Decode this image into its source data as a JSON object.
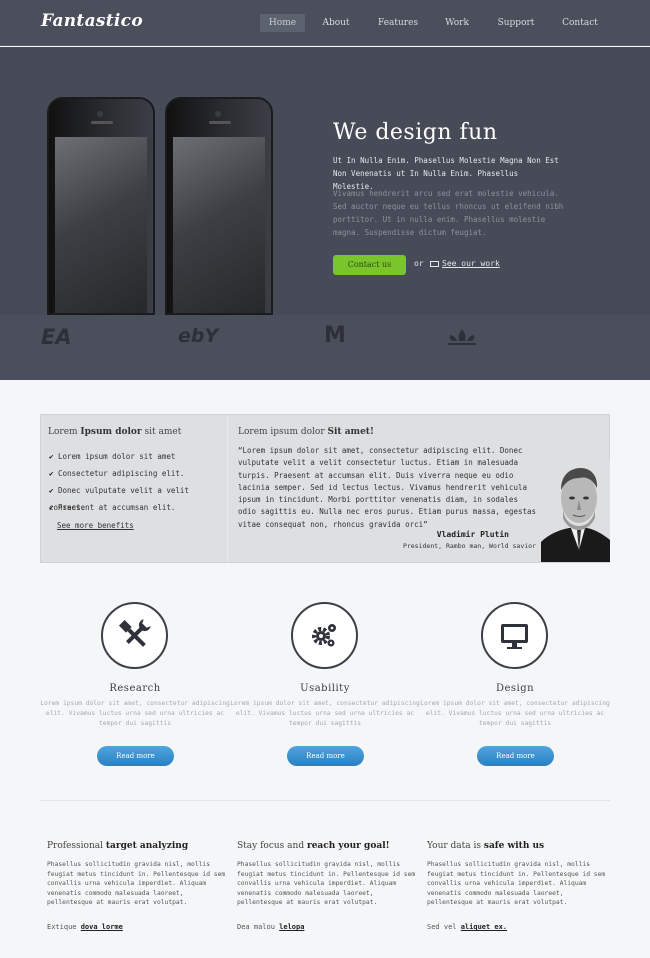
{
  "brand": {
    "logo": "Fantastico"
  },
  "nav": {
    "items": [
      "Home",
      "About",
      "Features",
      "Work",
      "Support",
      "Contact"
    ]
  },
  "hero": {
    "title": "We design fun",
    "subtitle": "Ut In Nulla Enim. Phasellus Molestie Magna Non Est Non Venenatis ut In Nulla Enim. Phasellus Molestie.",
    "text": "Vivamus hendrerit arcu sed erat molestie vehicula. Sed auctor neque eu tellus rhoncus ut eleifend nibh porttitor. Ut in nulla enim. Phasellus molestie magna. Suspendisse dictum feugiat.",
    "contact_label": "Contact us",
    "or_label": "or",
    "see_work_label": "See our work"
  },
  "clients": [
    "EA",
    "ebY",
    "M",
    "adidas"
  ],
  "testimonial": {
    "left_title_pre": "Lorem ",
    "left_title_bold": "Ipsum dolor",
    "left_title_post": " sit amet",
    "bullets": [
      "Lorem ipsum dolor sit amet",
      "Consectetur adipiscing elit.",
      "Donec vulputate velit a velit consect.",
      "Praesent at accumsan elit."
    ],
    "see_more": "See more benefits",
    "right_title_pre": "Lorem ipsum dolor ",
    "right_title_bold": "Sit amet!",
    "quote": "“Lorem ipsum dolor sit amet, consectetur adipiscing elit. Donec vulputate velit a velit consectetur luctus. Etiam in malesuada turpis. Praesent at accumsan elit. Duis viverra neque eu odio lacinia semper. Sed id lectus lectus. Vivamus hendrerit vehicula ipsum in tincidunt. Morbi porttitor venenatis diam, in sodales odio sagittis eu. Nulla nec eros purus. Etiam purus massa, egestas vitae consequat non, rhoncus gravida orci”",
    "name": "Vladimir Plutin",
    "role": "President, Rambo man, World savior"
  },
  "features": [
    {
      "icon": "tools-icon",
      "title": "Research",
      "text": "Lorem ipsum dolor sit amet, consectetur adipiscing elit. Vivamus luctus urna sed urna ultricies ac tempor dui sagittis",
      "button": "Read more"
    },
    {
      "icon": "gears-icon",
      "title": "Usability",
      "text": "Lorem ipsum dolor sit amet, consectetur adipiscing elit. Vivamus luctus urna sed urna ultricies ac tempor dui sagittis",
      "button": "Read more"
    },
    {
      "icon": "monitor-icon",
      "title": "Design",
      "text": "Lorem ipsum dolor sit amet, consectetur adipiscing elit. Vivamus luctus urna sed urna ultricies ac tempor dui sagittis",
      "button": "Read more"
    }
  ],
  "bottom": [
    {
      "title_pre": "Professional ",
      "title_bold": "target analyzing",
      "text": "Phasellus sollicitudin gravida nisl, mollis feugiat metus tincidunt in. Pellentesque id sem convallis urna vehicula imperdiet. Aliquam venenatis commodo malesuada laoreet, pellentesque at mauris erat volutpat.",
      "link_pre": "Extique ",
      "link": "dova lorme"
    },
    {
      "title_pre": "Stay focus and ",
      "title_bold": "reach your goal!",
      "text": "Phasellus sollicitudin gravida nisl, mollis feugiat metus tincidunt in. Pellentesque id sem convallis urna vehicula imperdiet. Aliquam venenatis commodo malesuada laoreet, pellentesque at mauris erat volutpat.",
      "link_pre": "Dea malou ",
      "link": "lelopa"
    },
    {
      "title_pre": "Your data is ",
      "title_bold": "safe with us",
      "text": "Phasellus sollicitudin gravida nisl, mollis feugiat metus tincidunt in. Pellentesque id sem convallis urna vehicula imperdiet. Aliquam venenatis commodo malesuada laoreet, pellentesque at mauris erat volutpat.",
      "link_pre": "Sed vel ",
      "link": "aliquet ex."
    }
  ],
  "colors": {
    "accent_green": "#7ac52b",
    "accent_blue": "#2a7fc0",
    "hero_bg": "#474b57"
  }
}
